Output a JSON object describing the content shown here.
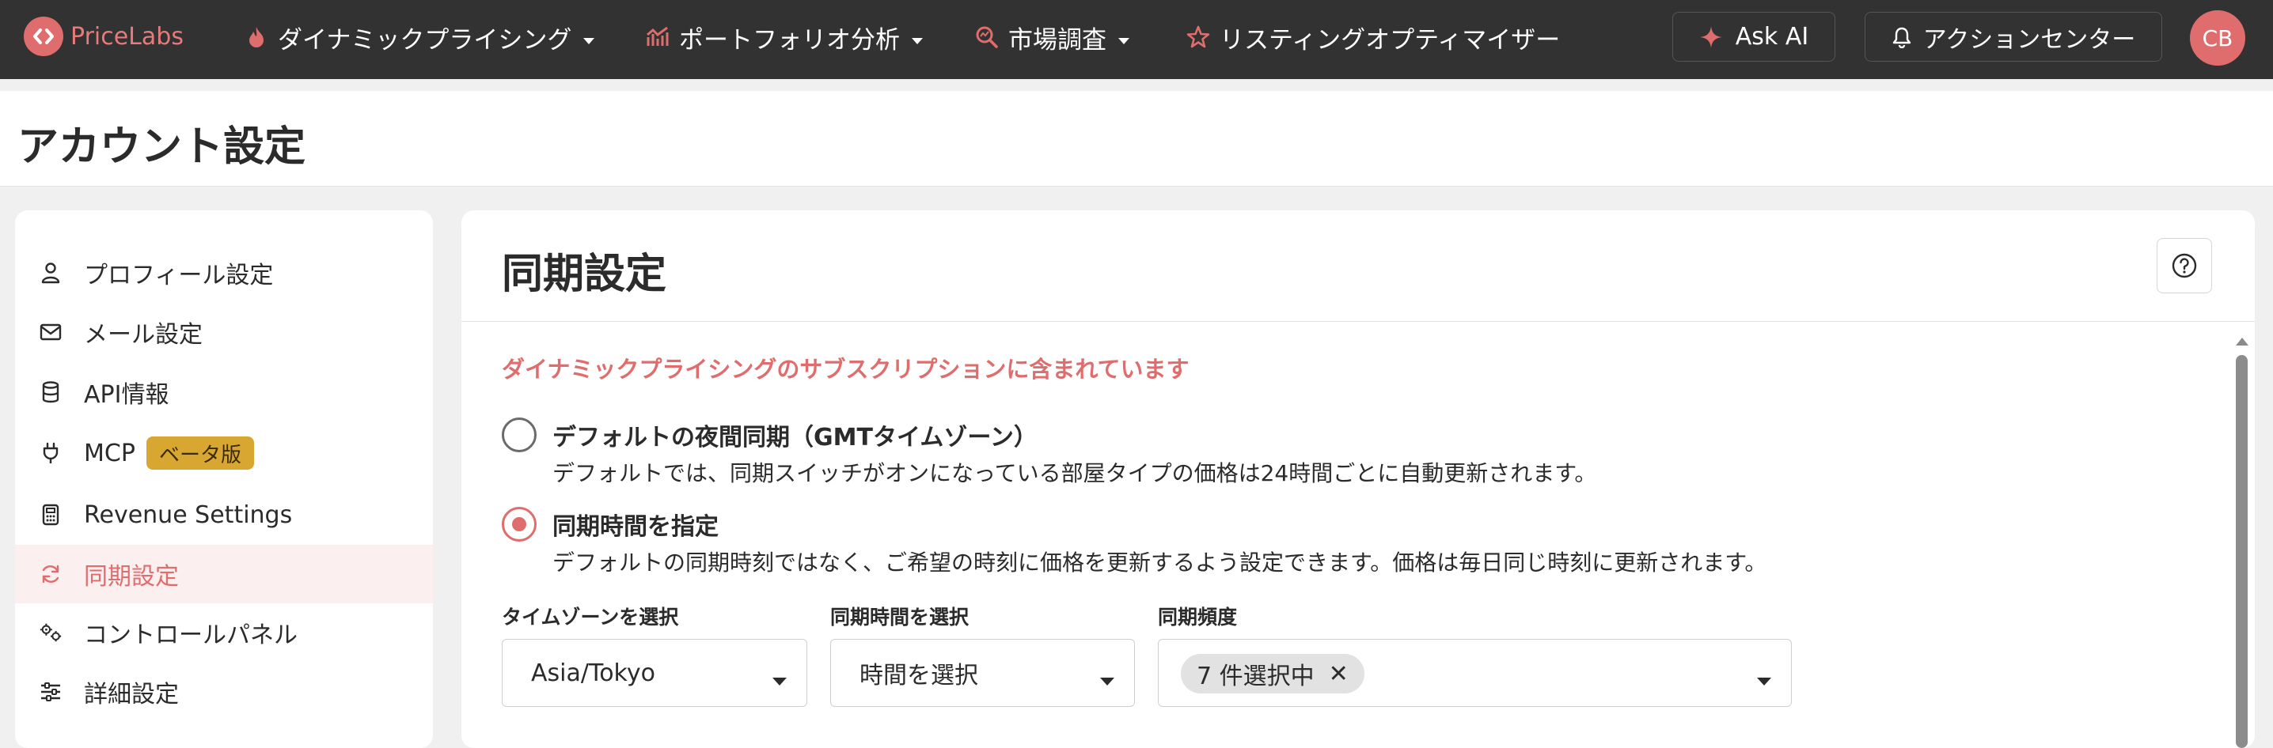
{
  "brand": {
    "name": "PriceLabs",
    "color": "#e06d6d"
  },
  "nav": {
    "items": [
      {
        "label": "ダイナミックプライシング",
        "icon": "flame-icon",
        "dropdown": true
      },
      {
        "label": "ポートフォリオ分析",
        "icon": "analytics-icon",
        "dropdown": true
      },
      {
        "label": "市場調査",
        "icon": "market-search-icon",
        "dropdown": true
      },
      {
        "label": "リスティングオプティマイザー",
        "icon": "star-optimizer-icon",
        "dropdown": false
      }
    ],
    "ask_ai": "Ask AI",
    "action_center": "アクションセンター",
    "avatar_initials": "CB"
  },
  "page": {
    "title": "アカウント設定"
  },
  "sidebar": {
    "items": [
      {
        "label": "プロフィール設定",
        "icon": "user-icon"
      },
      {
        "label": "メール設定",
        "icon": "mail-icon"
      },
      {
        "label": "API情報",
        "icon": "database-icon"
      },
      {
        "label": "MCP",
        "icon": "plug-icon",
        "badge": "ベータ版"
      },
      {
        "label": "Revenue Settings",
        "icon": "calculator-icon"
      },
      {
        "label": "同期設定",
        "icon": "sync-icon",
        "active": true
      },
      {
        "label": "コントロールパネル",
        "icon": "gears-icon"
      },
      {
        "label": "詳細設定",
        "icon": "sliders-icon"
      }
    ]
  },
  "main": {
    "title": "同期設定",
    "subscription_note": "ダイナミックプライシングのサブスクリプションに含まれています",
    "options": [
      {
        "title": "デフォルトの夜間同期（GMTタイムゾーン）",
        "description": "デフォルトでは、同期スイッチがオンになっている部屋タイプの価格は24時間ごとに自動更新されます。",
        "selected": false
      },
      {
        "title": "同期時間を指定",
        "description": "デフォルトの同期時刻ではなく、ご希望の時刻に価格を更新するよう設定できます。価格は毎日同じ時刻に更新されます。",
        "selected": true
      }
    ],
    "fields": {
      "timezone": {
        "label": "タイムゾーンを選択",
        "value": "Asia/Tokyo"
      },
      "sync_time": {
        "label": "同期時間を選択",
        "value": "時間を選択"
      },
      "frequency": {
        "label": "同期頻度",
        "chip": "7 件選択中"
      }
    }
  }
}
